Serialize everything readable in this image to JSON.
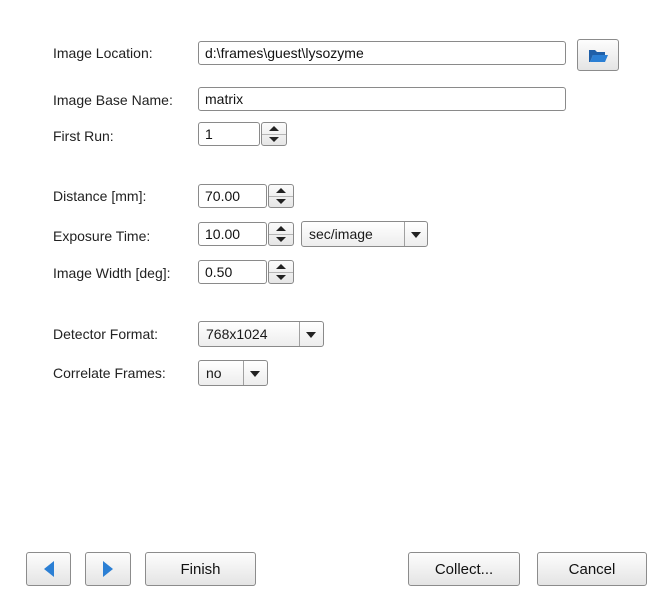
{
  "form": {
    "image_location": {
      "label": "Image Location:",
      "value": "d:\\frames\\guest\\lysozyme"
    },
    "image_base_name": {
      "label": "Image Base Name:",
      "value": "matrix"
    },
    "first_run": {
      "label": "First Run:",
      "value": "1"
    },
    "distance": {
      "label": "Distance [mm]:",
      "value": "70.00"
    },
    "exposure_time": {
      "label": "Exposure Time:",
      "value": "10.00",
      "unit": "sec/image"
    },
    "image_width": {
      "label": "Image Width [deg]:",
      "value": "0.50"
    },
    "detector_format": {
      "label": "Detector Format:",
      "value": "768x1024"
    },
    "correlate_frames": {
      "label": "Correlate Frames:",
      "value": "no"
    }
  },
  "icons": {
    "browse": "folder-open-icon",
    "back": "arrow-left-icon",
    "forward": "arrow-right-icon",
    "accent": "#2b7fd4"
  },
  "footer": {
    "finish_label": "Finish",
    "collect_label": "Collect...",
    "cancel_label": "Cancel"
  }
}
